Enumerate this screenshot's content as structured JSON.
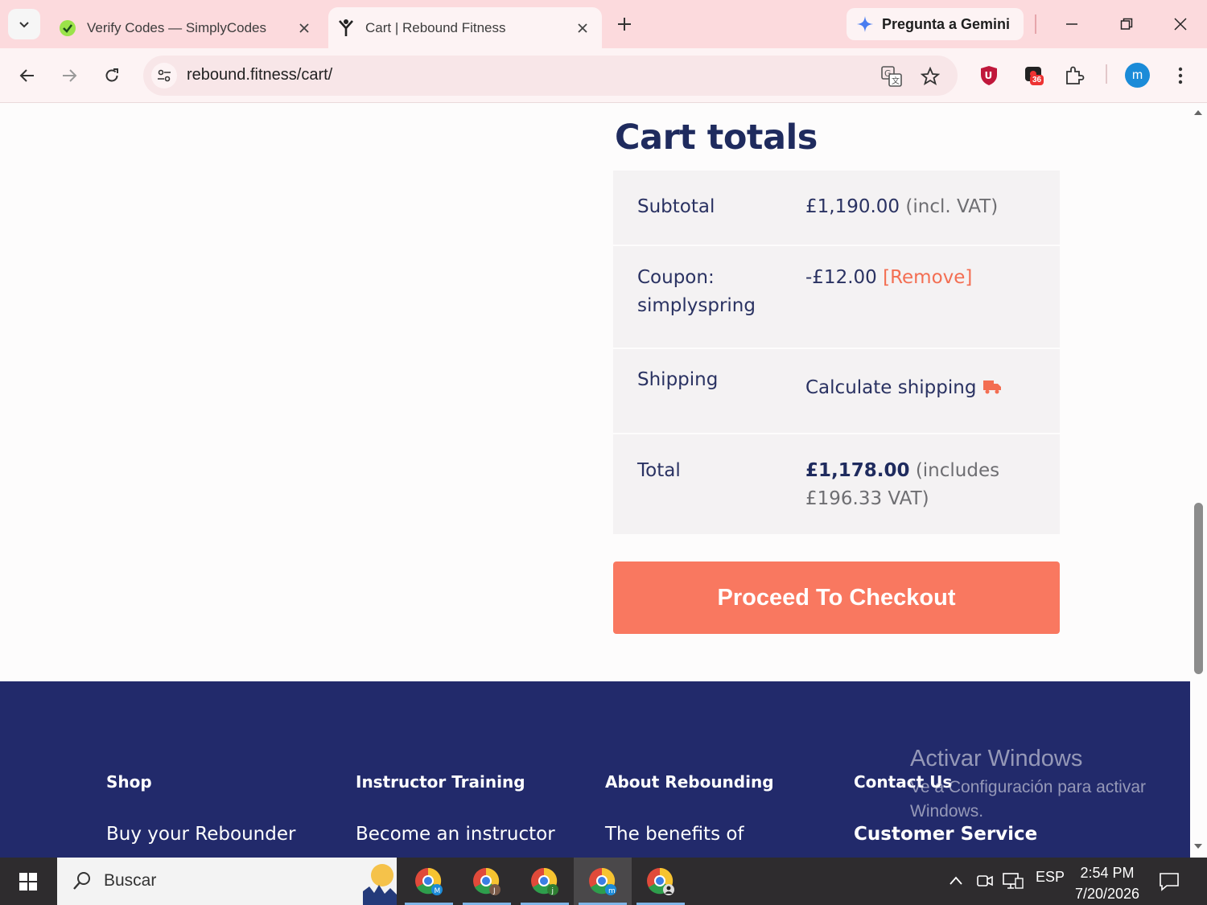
{
  "browser": {
    "tabs": [
      {
        "title": "Verify Codes — SimplyCodes",
        "active": false
      },
      {
        "title": "Cart | Rebound Fitness",
        "active": true
      }
    ],
    "gemini_label": "Pregunta a Gemini",
    "url": "rebound.fitness/cart/",
    "extension_badge": "36",
    "profile_initial": "m"
  },
  "cart": {
    "title": "Cart totals",
    "subtotal_label": "Subtotal",
    "subtotal_value": "£1,190.00",
    "subtotal_note": "(incl. VAT)",
    "coupon_label_line1": "Coupon:",
    "coupon_label_line2": "simplyspring",
    "coupon_value": "-£12.00",
    "coupon_remove": "[Remove]",
    "shipping_label": "Shipping",
    "shipping_link": "Calculate shipping",
    "total_label": "Total",
    "total_value": "£1,178.00",
    "total_note_line1": "(includes",
    "total_note_line2": "£196.33 VAT)",
    "checkout_button": "Proceed To Checkout"
  },
  "footer": {
    "columns": [
      {
        "heading": "Shop",
        "link": "Buy your Rebounder"
      },
      {
        "heading": "Instructor Training",
        "link": "Become an instructor"
      },
      {
        "heading": "About Rebounding",
        "link": "The benefits of"
      },
      {
        "heading": "Contact Us",
        "link": "Customer Service"
      }
    ]
  },
  "watermark": {
    "title": "Activar Windows",
    "text": "Ve a Configuración para activar Windows."
  },
  "taskbar": {
    "search_placeholder": "Buscar",
    "language": "ESP",
    "time": "2:54 PM",
    "date": "7/20/2026"
  },
  "colors": {
    "accent": "#f97860",
    "navy": "#222a6b",
    "tabstrip": "#fcdadd"
  }
}
